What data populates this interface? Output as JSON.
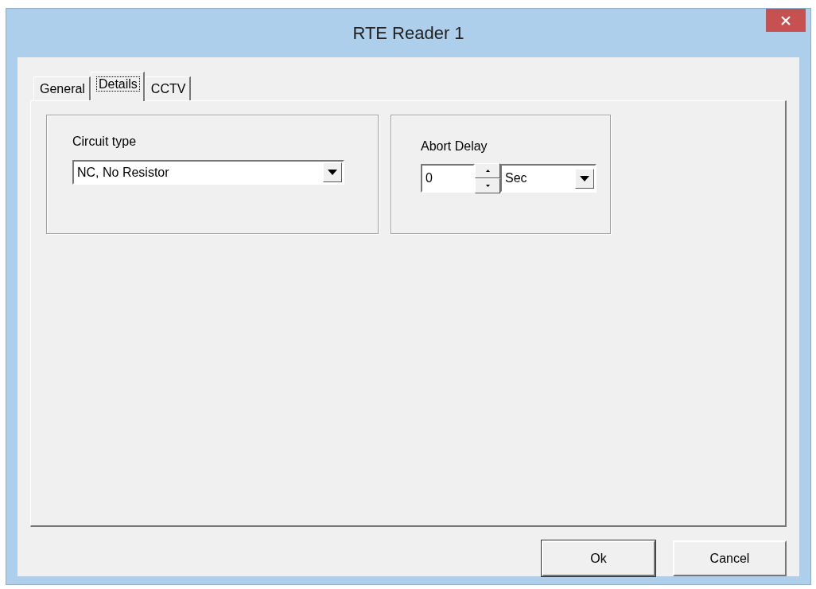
{
  "window": {
    "title": "RTE Reader 1"
  },
  "tabs": [
    {
      "label": "General",
      "selected": false
    },
    {
      "label": "Details",
      "selected": true
    },
    {
      "label": "CCTV",
      "selected": false
    }
  ],
  "circuit_group": {
    "label": "Circuit type",
    "value": "NC, No Resistor"
  },
  "abort_group": {
    "label": "Abort Delay",
    "value": "0",
    "unit": "Sec"
  },
  "buttons": [
    {
      "label": "Ok",
      "default": true
    },
    {
      "label": "Cancel",
      "default": false
    }
  ]
}
